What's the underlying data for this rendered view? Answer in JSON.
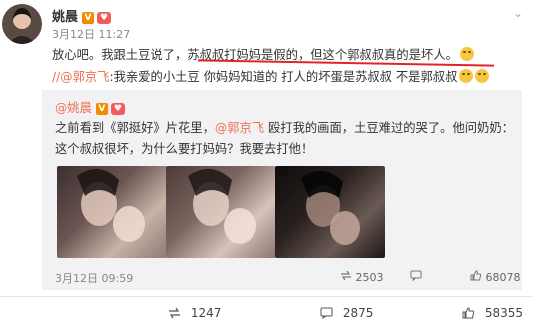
{
  "post": {
    "author": "姚晨",
    "time": "3月12日 11:27",
    "line1": "放心吧。我跟土豆说了，苏叔叔打妈妈是假的，但这个郭叔叔真的是坏人。",
    "line2_mention": "//@郭京飞",
    "line2_text": ":我亲爱的小土豆 你妈妈知道的 打人的坏蛋是苏叔叔 不是郭叔叔"
  },
  "repost": {
    "author": "@姚晨",
    "text1": "之前看到《郭挺好》片花里，",
    "mention": "@郭京飞",
    "text2": " 殴打我的画面，土豆难过的哭了。他问奶奶：这个叔叔很坏，为什么要打妈妈？我要去打他！",
    "time": "3月12日 09:59",
    "repost_count": "2503",
    "comment_count": "",
    "like_count": "68078"
  },
  "actions": {
    "repost": "1247",
    "comment": "2875",
    "like": "58355"
  },
  "colors": {
    "link": "#eb7350",
    "underline": "#e0252a",
    "repost_bg": "#f2f2f5"
  }
}
